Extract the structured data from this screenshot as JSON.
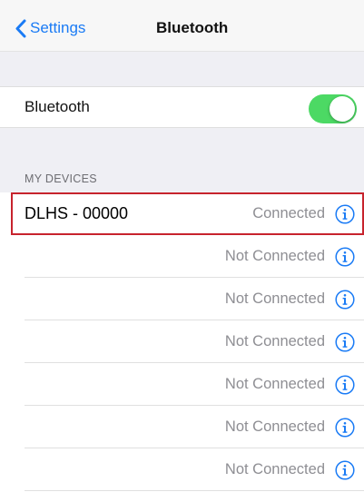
{
  "navbar": {
    "back_label": "Settings",
    "title": "Bluetooth"
  },
  "bluetooth_row": {
    "label": "Bluetooth",
    "toggle_on": true,
    "toggle_color": "#4cd964"
  },
  "section_header": "MY DEVICES",
  "devices": [
    {
      "name": "DLHS - 00000",
      "status": "Connected"
    },
    {
      "name": "",
      "status": "Not Connected"
    },
    {
      "name": "",
      "status": "Not Connected"
    },
    {
      "name": "",
      "status": "Not Connected"
    },
    {
      "name": "",
      "status": "Not Connected"
    },
    {
      "name": "",
      "status": "Not Connected"
    },
    {
      "name": "",
      "status": "Not Connected"
    }
  ],
  "colors": {
    "accent": "#1a7bf5",
    "highlight_border": "#c7232d"
  }
}
